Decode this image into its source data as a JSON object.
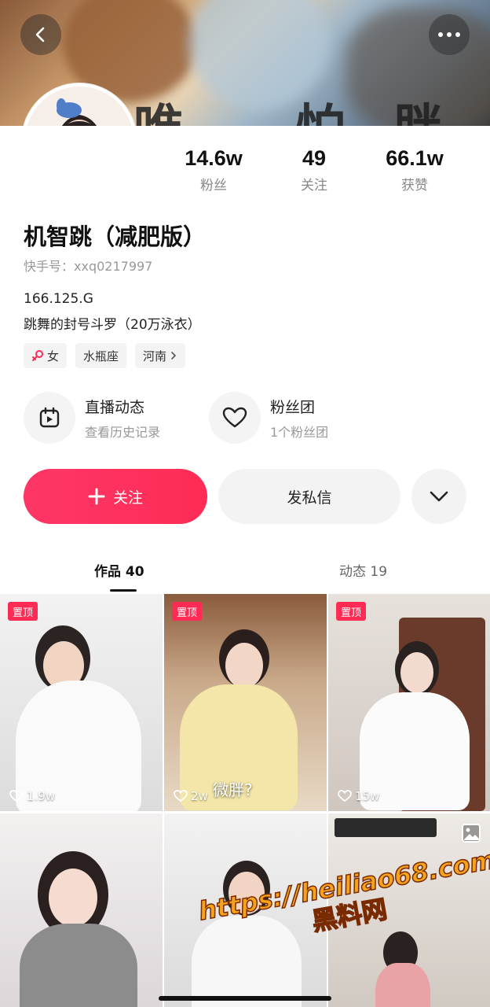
{
  "cover": {
    "overlay_text": "唯 怕胖"
  },
  "profile": {
    "name": "机智跳（减肥版）",
    "kuaishou_id": "快手号：xxq0217997",
    "bio_line1": "166.125.G",
    "bio_line2": "跳舞的封号斗罗（20万泳衣）"
  },
  "stats": [
    {
      "value": "14.6w",
      "label": "粉丝"
    },
    {
      "value": "49",
      "label": "关注"
    },
    {
      "value": "66.1w",
      "label": "获赞"
    }
  ],
  "tags": [
    {
      "label": "女",
      "icon": "female-icon"
    },
    {
      "label": "水瓶座"
    },
    {
      "label": "河南",
      "icon": "chevron-right-icon"
    }
  ],
  "features": [
    {
      "title": "直播动态",
      "subtitle": "查看历史记录",
      "icon": "live-calendar-icon"
    },
    {
      "title": "粉丝团",
      "subtitle": "1个粉丝团",
      "icon": "heart-badge-icon"
    }
  ],
  "actions": {
    "follow": "关注",
    "message": "发私信"
  },
  "tabs": [
    {
      "label": "作品",
      "count": "40"
    },
    {
      "label": "动态",
      "count": "19"
    }
  ],
  "videos": [
    {
      "pinned": "置顶",
      "likes": "1.9w",
      "caption": ""
    },
    {
      "pinned": "置顶",
      "likes": "2w",
      "caption": "微胖?"
    },
    {
      "pinned": "置顶",
      "likes": "15w",
      "caption": ""
    },
    {
      "pinned": "",
      "likes": "",
      "caption": ""
    },
    {
      "pinned": "",
      "likes": "",
      "caption": ""
    },
    {
      "pinned": "",
      "likes": "",
      "caption": "",
      "badge": "image-icon"
    }
  ],
  "watermark": {
    "url": "https://heiliao68.com",
    "name": "黑料网"
  },
  "colors": {
    "accent": "#fe2c55",
    "muted": "#999999"
  }
}
